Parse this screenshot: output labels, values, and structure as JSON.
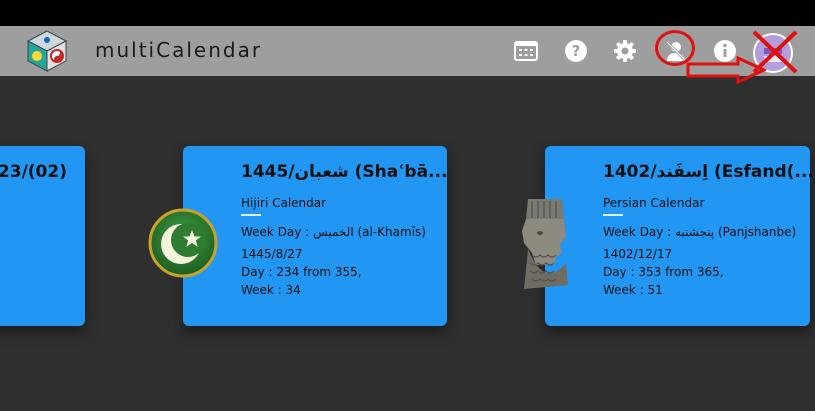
{
  "app": {
    "title": "multiCalendar",
    "icons": [
      "app-logo-icon",
      "calendar-grid-icon",
      "help-icon",
      "gear-icon",
      "user-remove-icon",
      "info-icon",
      "avatar-icon"
    ]
  },
  "cards": {
    "left": {
      "title": "‏(02)/23"
    },
    "hijri": {
      "title": "1445/شعبان (Shaʿbā...",
      "subtitle": "Hijiri Calendar",
      "weekday": "Week Day :  الخميس (al-Khamīs)",
      "date": "1445/8/27",
      "day": "Day :  234 from  355,",
      "week": "Week :  34"
    },
    "persian": {
      "title": "1402/اِسفَند (Esfand(...",
      "subtitle": "Persian Calendar",
      "weekday": "Week Day :  پنجشنبه (Panjshanbe)",
      "date": "1402/12/17",
      "day": "Day :  353 from  365,",
      "week": "Week :  51"
    }
  },
  "colors": {
    "appbar": "#9e9e9e",
    "card": "#2196f3",
    "background": "#2f2f2f",
    "annotation": "#e01010"
  }
}
